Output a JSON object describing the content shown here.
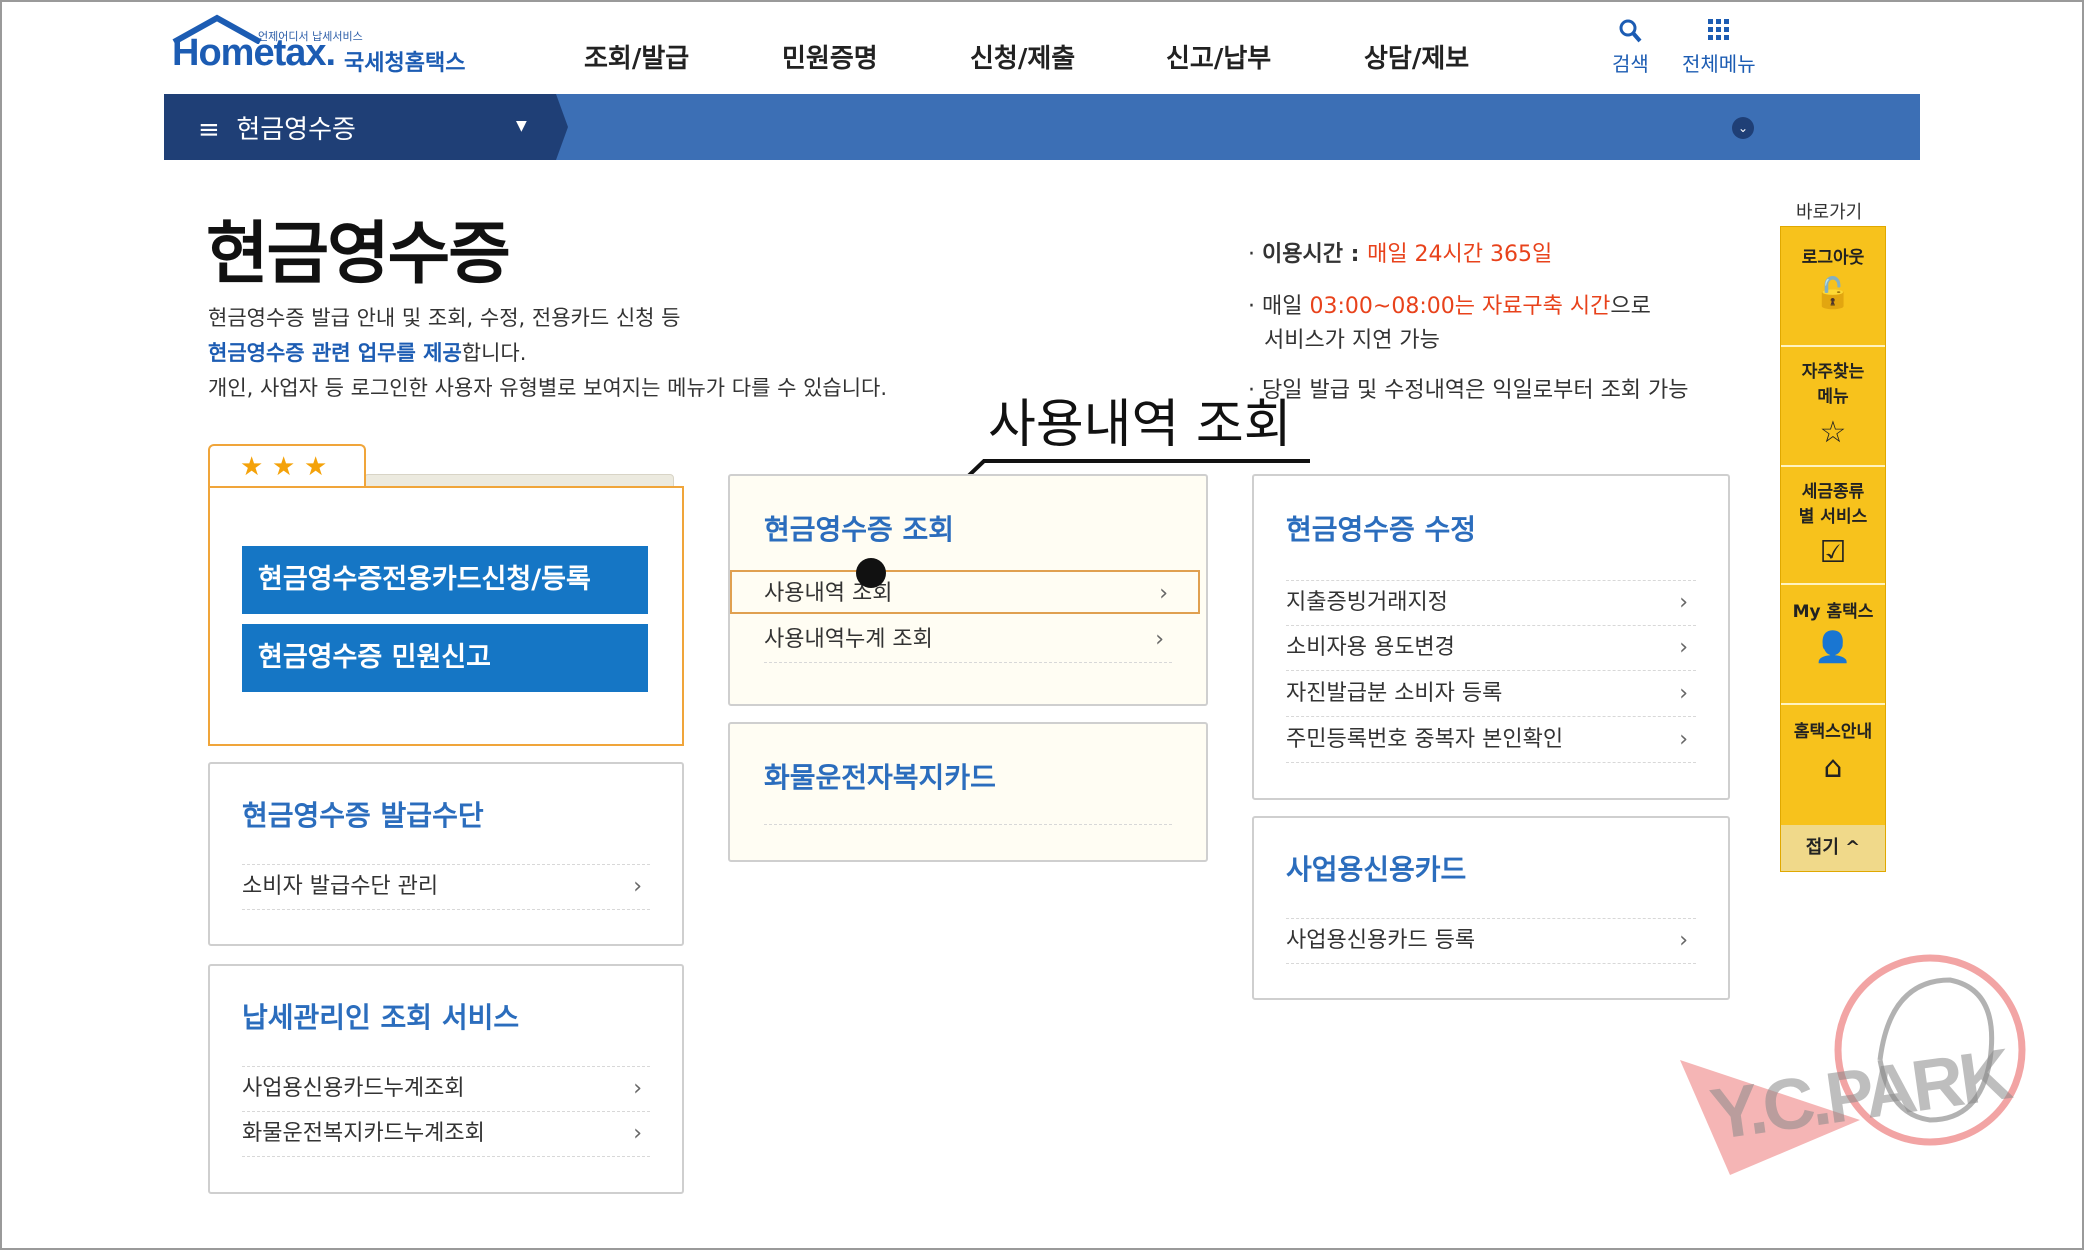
{
  "header": {
    "logo_small": "언제어디서 납세서비스",
    "logo_main": "Hometax.",
    "logo_sub": "국세청홈택스",
    "gnb": [
      "조회/발급",
      "민원증명",
      "신청/제출",
      "신고/납부",
      "상담/제보"
    ],
    "search_label": "검색",
    "allmenu_label": "전체메뉴"
  },
  "navbar": {
    "title": "현금영수증"
  },
  "page": {
    "title": "현금영수증",
    "desc_line1": "현금영수증 발급 안내 및 조회, 수정, 전용카드 신청 등",
    "desc_line2_blue": "현금영수증 관련 업무를 제공",
    "desc_line2_rest": "합니다.",
    "desc_line3": "개인, 사업자 등 로그인한 사용자 유형별로 보여지는 메뉴가 다를 수 있습니다.",
    "info1_label": "이용시간 : ",
    "info1_value": "매일 24시간 365일",
    "info2_pre": "매일 ",
    "info2_red": "03:00~08:00는 자료구축 시간",
    "info2_post": "으로",
    "info2_line2": "서비스가 지연 가능",
    "info3": "당일 발급 및 수정내역은 익일로부터 조회 가능"
  },
  "callout": "사용내역 조회",
  "fav": {
    "btn1": "현금영수증전용카드신청/등록",
    "btn2": "현금영수증 민원신고"
  },
  "cards": {
    "issue_means": {
      "title": "현금영수증 발급수단",
      "items": [
        "소비자 발급수단 관리"
      ]
    },
    "agent": {
      "title": "납세관리인 조회 서비스",
      "items": [
        "사업용신용카드누계조회",
        "화물운전복지카드누계조회"
      ]
    },
    "inquiry": {
      "title": "현금영수증 조회",
      "items": [
        "사용내역 조회",
        "사용내역누계 조회"
      ]
    },
    "cargo": {
      "title": "화물운전자복지카드"
    },
    "modify": {
      "title": "현금영수증 수정",
      "items": [
        "지출증빙거래지정",
        "소비자용 용도변경",
        "자진발급분 소비자 등록",
        "주민등록번호 중복자 본인확인"
      ]
    },
    "biz_card": {
      "title": "사업용신용카드",
      "items": [
        "사업용신용카드 등록"
      ]
    }
  },
  "quick": {
    "label": "바로가기",
    "items": [
      "로그아웃",
      "자주찾는 메뉴",
      "세금종류별 서비스",
      "My 홈택스",
      "홈택스안내"
    ],
    "close": "접기 ^"
  },
  "watermark": "Y.C.PARK",
  "colors": {
    "navbar": "#3c6fb5",
    "navbar_dark": "#1f3f76",
    "accent_blue": "#1576c5",
    "quick_yellow": "#f7c21c",
    "highlight_red": "#e8421b"
  }
}
